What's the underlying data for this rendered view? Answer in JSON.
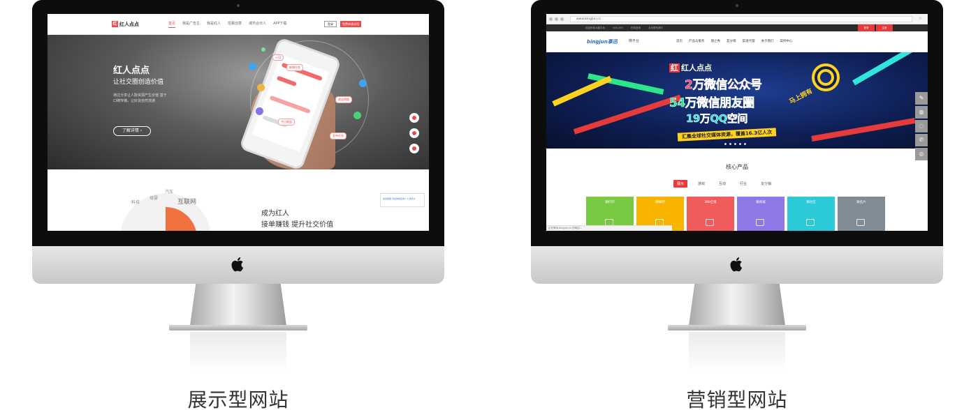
{
  "colors": {
    "accent_red": "#e94c4c",
    "banner_blue": "#0f1f55",
    "silver": "#d0d0d0",
    "bezel": "#0d0d0d"
  },
  "left": {
    "caption": "展示型网站",
    "site": {
      "logo": "红人点点",
      "logo_mark": "红",
      "nav": [
        "首页",
        "我是广告主",
        "我是红人",
        "招募创意",
        "城市合伙人",
        "APP下载"
      ],
      "login": "登录",
      "free_btn": "免费申请试用",
      "hero_title": "红人点点",
      "hero_subtitle": "让社交圈创造价值",
      "hero_desc": "通过分享让人脉资源产生价值 基于口碑传播，让好货自然流通",
      "hero_button": "了解详情 ›",
      "phone_tags": [
        "+22",
        "新增任务",
        "收益明细",
        "今日收益",
        "发布任务"
      ],
      "wheel_words": [
        "汽车",
        "互联网",
        "母婴",
        "科技"
      ],
      "section_title": "成为红人",
      "section_tagline": "接单赚钱 提升社交价值",
      "chat_widget": "在线客服 可加微信咨询 1.0 版售价"
    }
  },
  "right": {
    "caption": "营销型网站",
    "site": {
      "url": "www.bingjun.cc",
      "topbar": [
        "欢迎来到冰晶平台",
        "400-400",
        "在线咨询",
        "点击联系我们"
      ],
      "top_buttons": [
        "登录",
        "注册"
      ],
      "logo": "bingjun事迅",
      "logo_sub": "微平台",
      "nav": [
        "首页",
        "产品与服务",
        "朋之秀",
        "友分销",
        "渠道代理",
        "关于我们",
        "案例中心"
      ],
      "banner": {
        "brand": "红人点点",
        "brand_mark": "红",
        "line1": "2万微信公众号",
        "line2": "54万微信朋友圈",
        "line3": "19万QQ空间",
        "line4": "汇集全球社交媒体资源，覆盖16.3亿人次",
        "badge": "马上拥有"
      },
      "side_icons": [
        "pencil-icon",
        "qq-icon",
        "chat-icon",
        "phone-icon",
        "wechat-icon"
      ],
      "section_title": "核心产品",
      "tabs": [
        "展示",
        "游戏",
        "互动",
        "行业",
        "友分销"
      ],
      "active_tab": "展示",
      "tiles": [
        {
          "label": "微打印",
          "color": "#7ac943"
        },
        {
          "label": "微聊吧",
          "color": "#f7b500"
        },
        {
          "label": "360全景",
          "color": "#f25b5b"
        },
        {
          "label": "微商城",
          "color": "#8e79e6"
        },
        {
          "label": "微社区",
          "color": "#2cc9d6"
        },
        {
          "label": "微名片",
          "color": "#7f8c96"
        }
      ],
      "status_text": "正在等待 bingjun.cc 的响应..."
    }
  }
}
